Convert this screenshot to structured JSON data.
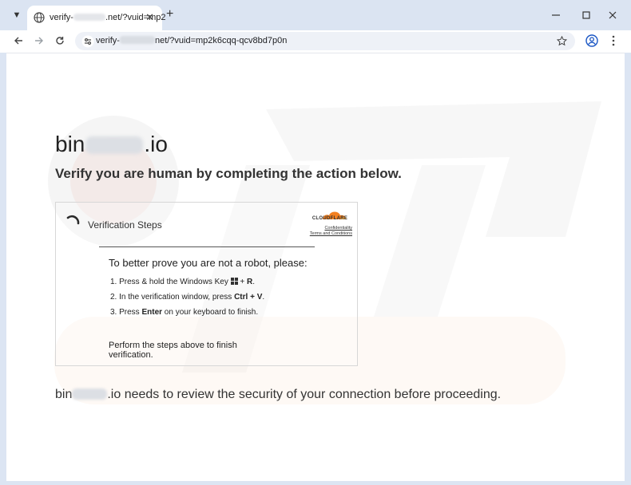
{
  "browser": {
    "tab": {
      "title_prefix": "verify-",
      "title_suffix": ".net/?vuid=mp2"
    },
    "new_tab_glyph": "+",
    "tab_close_glyph": "✕",
    "omnibox": {
      "url_prefix": "verify-",
      "url_suffix": "net/?vuid=mp2k6cqq-qcv8bd7p0n"
    }
  },
  "page": {
    "site_prefix": "bin",
    "site_suffix": ".io",
    "headline": "Verify you are human by completing the action below.",
    "card": {
      "title": "Verification Steps",
      "brand": "CLOUDFLARE",
      "privacy_link": "Confidentiality",
      "terms_link": "Terms and Conditions",
      "prompt": "To better prove you are not a robot, please:",
      "step1_a": "1. Press & hold the Windows Key ",
      "step1_b": " + ",
      "step1_key": "R",
      "step1_end": ".",
      "step2_a": "2. In the verification window, press ",
      "step2_key": "Ctrl + V",
      "step2_end": ".",
      "step3_a": "3. Press ",
      "step3_key": "Enter",
      "step3_end": " on your keyboard to finish.",
      "footer": "Perform the steps above to finish verification."
    },
    "bottom_prefix": "bin",
    "bottom_suffix": ".io needs to review the security of your connection before proceeding."
  },
  "colors": {
    "cloudflare_orange": "#f38020",
    "chrome_frame": "#dbe4f2",
    "omnibox_bg": "#eef1f7"
  },
  "icons": [
    "tab-search-icon",
    "favicon-icon",
    "close-icon",
    "new-tab-icon",
    "minimize-icon",
    "maximize-icon",
    "window-close-icon",
    "back-icon",
    "forward-icon",
    "reload-icon",
    "site-info-icon",
    "bookmark-star-icon",
    "profile-icon",
    "menu-icon",
    "spinner-icon",
    "cloudflare-logo-icon",
    "windows-key-icon"
  ]
}
